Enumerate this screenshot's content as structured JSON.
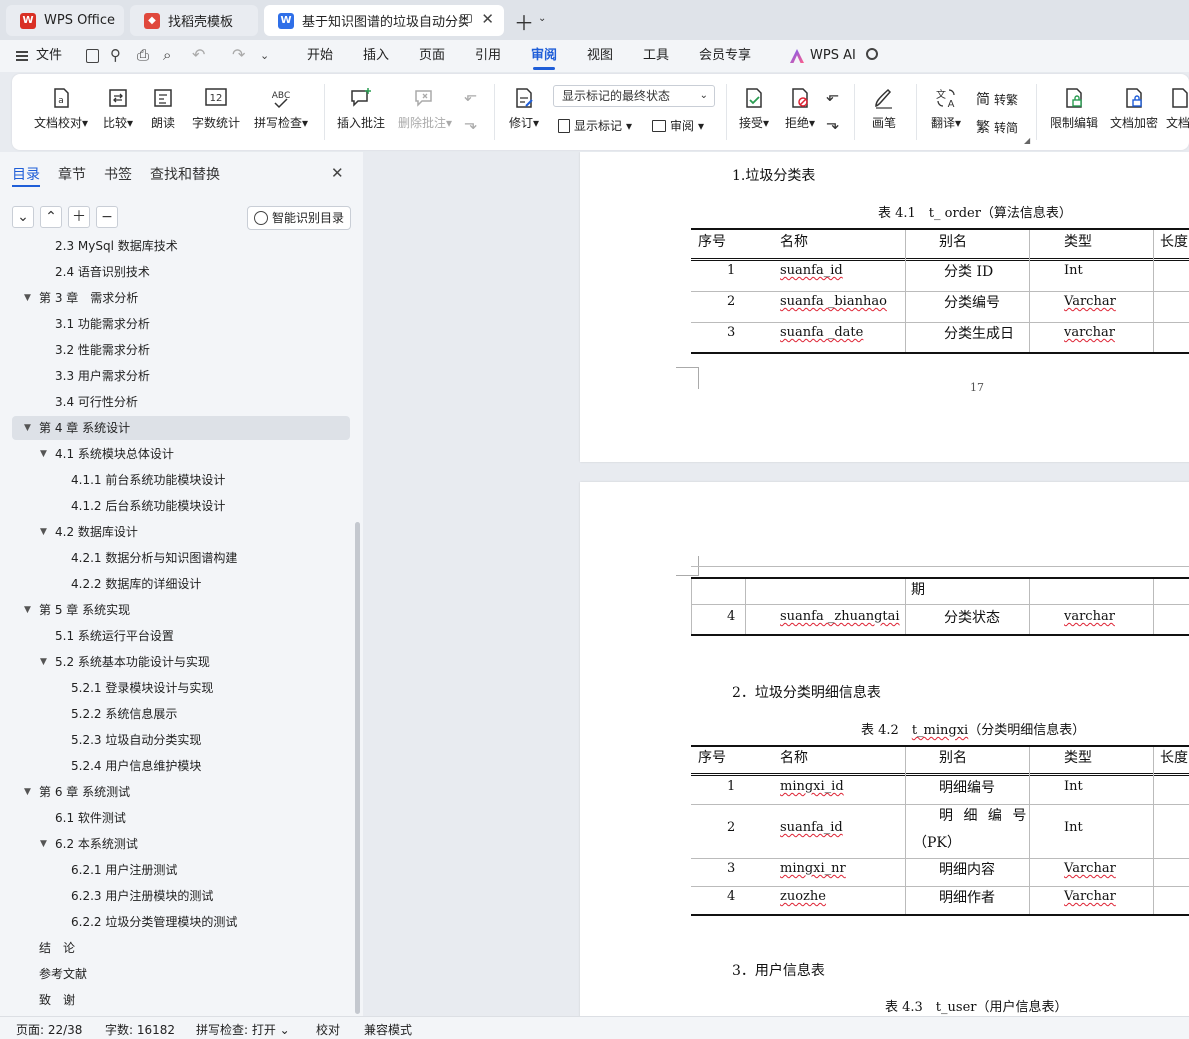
{
  "tabs": [
    {
      "label": "WPS Office"
    },
    {
      "label": "找稻壳模板"
    },
    {
      "label": "基于知识图谱的垃圾自动分类"
    }
  ],
  "menu": {
    "file": "文件",
    "items": [
      "开始",
      "插入",
      "页面",
      "引用",
      "审阅",
      "视图",
      "工具",
      "会员专享"
    ],
    "ai": "WPS AI"
  },
  "ribbon": {
    "doc_check": "文档校对",
    "compare": "比较",
    "read_aloud": "朗读",
    "word_count": "字数统计",
    "spell_check": "拼写检查",
    "insert_comment": "插入批注",
    "delete_comment": "删除批注",
    "revise": "修订",
    "markup_state": "显示标记的最终状态",
    "show_markup": "显示标记",
    "review": "审阅",
    "accept": "接受",
    "reject": "拒绝",
    "pen": "画笔",
    "translate": "翻译",
    "to_trad": "转繁",
    "to_simp": "转简",
    "restrict": "限制编辑",
    "encrypt": "文档加密",
    "more": "文档",
    "word_count_icon_text": "12",
    "spell_icon_text": "ABC"
  },
  "sidebar": {
    "tabs": [
      "目录",
      "章节",
      "书签",
      "查找和替换"
    ],
    "smart_toc": "智能识别目录",
    "items": [
      "2.3 MySql 数据库技术",
      "2.4 语音识别技术",
      "第 3 章　需求分析",
      "3.1 功能需求分析",
      "3.2 性能需求分析",
      "3.3 用户需求分析",
      "3.4 可行性分析",
      "第 4 章 系统设计",
      "4.1 系统模块总体设计",
      "4.1.1 前台系统功能模块设计",
      "4.1.2 后台系统功能模块设计",
      "4.2 数据库设计",
      "4.2.1 数据分析与知识图谱构建",
      "4.2.2 数据库的详细设计",
      "第 5 章 系统实现",
      "5.1 系统运行平台设置",
      "5.2 系统基本功能设计与实现",
      "5.2.1 登录模块设计与实现",
      "5.2.2 系统信息展示",
      "5.2.3 垃圾自动分类实现",
      "5.2.4 用户信息维护模块",
      "第 6 章 系统测试",
      "6.1 软件测试",
      "6.2 本系统测试",
      "6.2.1 用户注册测试",
      "6.2.3 用户注册模块的测试",
      "6.2.2 垃圾分类管理模块的测试",
      "结　论",
      "参考文献",
      "致　谢"
    ]
  },
  "doc": {
    "sec1": "1.垃圾分类表",
    "cap1": "表 4.1　t_ order（算法信息表）",
    "headers": [
      "序号",
      "名称",
      "别名",
      "类型",
      "长度"
    ],
    "t1": [
      [
        "1",
        "suanfa_id",
        "分类 ID",
        "Int"
      ],
      [
        "2",
        "suanfa _bianhao",
        "分类编号",
        "Varchar"
      ],
      [
        "3",
        "suanfa _date",
        "分类生成日",
        "varchar"
      ]
    ],
    "page_no": "17",
    "cont": "期",
    "t1b": [
      "4",
      "suanfa _zhuangtai",
      "分类状态",
      "varchar"
    ],
    "sec2": "2．垃圾分类明细信息表",
    "cap2_pre": "表 4.2　",
    "cap2_name": "t_mingxi",
    "cap2_post": "（分类明细信息表）",
    "t2": [
      [
        "1",
        "mingxi_id",
        "明细编号",
        "Int"
      ],
      [
        "2",
        "suanfa_id",
        "明 细 编 号",
        "Int"
      ],
      [
        "3",
        "mingxi_nr",
        "明细内容",
        "Varchar"
      ],
      [
        "4",
        "zuozhe",
        "明细作者",
        "Varchar"
      ]
    ],
    "t2_pk": "（PK）",
    "sec3": "3．用户信息表",
    "cap3": "表 4.3　t_user（用户信息表）"
  },
  "status": {
    "page": "页面: 22/38",
    "words": "字数: 16182",
    "spell": "拼写检查: 打开 ⌄",
    "proof": "校对",
    "compat": "兼容模式"
  }
}
